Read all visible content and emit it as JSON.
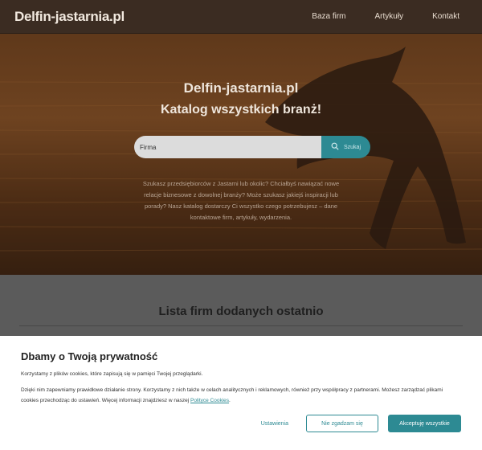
{
  "header": {
    "brand": "Delfin-jastarnia.pl",
    "nav": [
      "Baza firm",
      "Artykuły",
      "Kontakt"
    ]
  },
  "hero": {
    "title": "Delfin-jastarnia.pl",
    "subtitle": "Katalog wszystkich branż!",
    "search": {
      "placeholder": "Firma",
      "button_label": "Szukaj",
      "button_icon": "search-icon"
    },
    "description": "Szukasz przedsiębiorców z Jastarni lub okolic? Chciałbyś nawiązać nowe relacje biznesowe z dowolnej branży? Może szukasz jakiejś inspiracji lub porady? Nasz katalog dostarczy Ci wszystko czego potrzebujesz – dane kontaktowe firm, artykuły, wydarzenia."
  },
  "list_section": {
    "title": "Lista firm dodanych ostatnio"
  },
  "cookie": {
    "title": "Dbamy o Twoją prywatność",
    "text1": "Korzystamy z plików cookies, które zapisują się w pamięci Twojej przeglądarki.",
    "text2_before": "Dzięki nim zapewniamy prawidłowe działanie strony. Korzystamy z nich także w celach analitycznych i reklamowych, również przy współpracy z partnerami. Możesz zarządzać plikami cookies przechodząc do ustawień. Więcej informacji znajdziesz w naszej ",
    "link": "Polityce Cookies",
    "text2_after": ".",
    "settings_label": "Ustawienia",
    "reject_label": "Nie zgadzam się",
    "accept_label": "Akceptuję wszystkie"
  },
  "colors": {
    "accent": "#2d8a93",
    "header_bg": "#3b2c22",
    "section_bg": "#5b5b5b"
  }
}
